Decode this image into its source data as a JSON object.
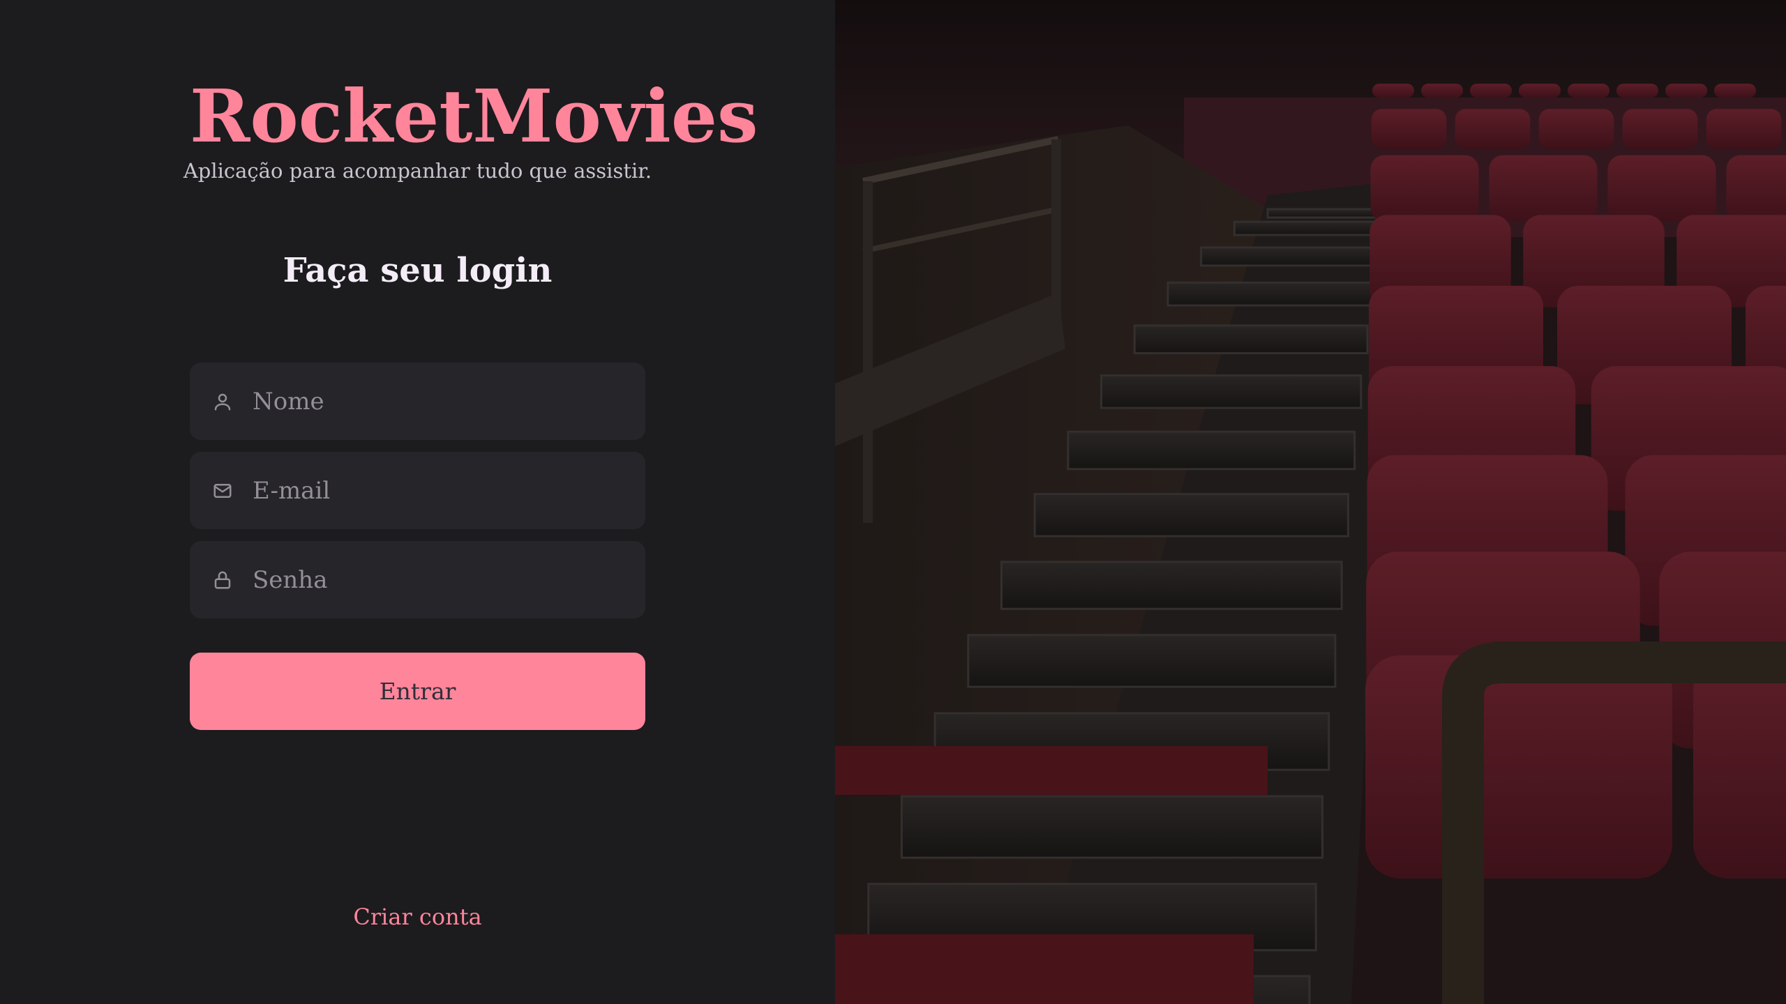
{
  "app": {
    "brand": "RocketMovies",
    "tagline": "Aplicação para acompanhar tudo que assistir."
  },
  "login": {
    "title": "Faça seu login",
    "fields": {
      "name": {
        "placeholder": "Nome",
        "icon": "user-icon"
      },
      "email": {
        "placeholder": "E-mail",
        "icon": "mail-icon"
      },
      "password": {
        "placeholder": "Senha",
        "icon": "lock-icon"
      }
    },
    "submit_label": "Entrar",
    "create_account_label": "Criar conta"
  },
  "colors": {
    "background": "#1c1b1e",
    "input_background": "#262529",
    "accent": "#ff859b",
    "title_text": "#f4edf8",
    "muted_text": "#948f99"
  }
}
